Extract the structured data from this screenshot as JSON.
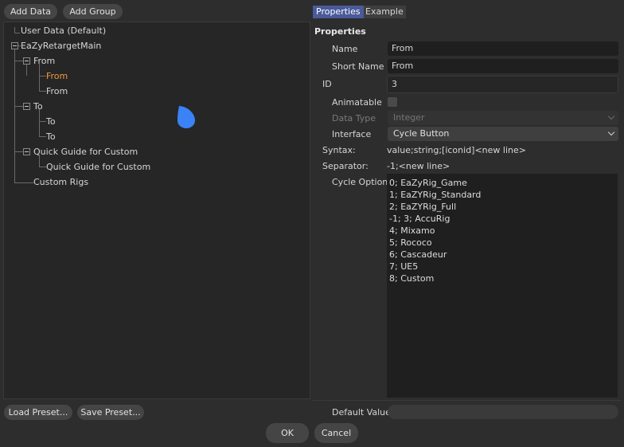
{
  "toolbar": {
    "add_data": "Add Data",
    "add_group": "Add Group"
  },
  "tabs": {
    "properties": "Properties",
    "example": "Example"
  },
  "tree": {
    "items": [
      {
        "label": "User Data (Default)"
      },
      {
        "label": "EaZyRetargetMain"
      },
      {
        "label": "From"
      },
      {
        "label": "From",
        "selected": true
      },
      {
        "label": "From"
      },
      {
        "label": "To"
      },
      {
        "label": "To"
      },
      {
        "label": "To"
      },
      {
        "label": "Quick Guide for Custom"
      },
      {
        "label": "Quick Guide for Custom"
      },
      {
        "label": "Custom Rigs"
      }
    ]
  },
  "properties": {
    "heading": "Properties",
    "name_label": "Name",
    "name_value": "From",
    "short_name_label": "Short Name",
    "short_name_value": "From",
    "id_label": "ID",
    "id_value": "3",
    "animatable_label": "Animatable",
    "data_type_label": "Data Type",
    "data_type_value": "Integer",
    "interface_label": "Interface",
    "interface_value": "Cycle Button",
    "syntax_label": "Syntax:",
    "syntax_value": "value;string;[iconid]<new line>",
    "separator_label": "Separator:",
    "separator_value": "-1;<new line>",
    "cycle_label": "Cycle Option",
    "cycle_options": [
      "0; EaZyRig_Game",
      "1; EaZYRig_Standard",
      "2; EaZYRig_Full",
      "-1; 3; AccuRig",
      "4; Mixamo",
      "5; Rococo",
      "6; Cascadeur",
      "7; UE5",
      "8; Custom"
    ],
    "default_value_label": "Default Value",
    "default_value": ""
  },
  "footer": {
    "load_preset": "Load Preset...",
    "save_preset": "Save Preset...",
    "ok": "OK",
    "cancel": "Cancel"
  },
  "colors": {
    "accent_tab": "#4a5a9a",
    "selected_item": "#f29a3c",
    "cursor_drop": "#3b82f6"
  }
}
